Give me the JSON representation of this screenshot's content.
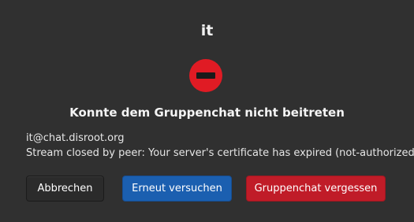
{
  "dialog": {
    "window_title": "it",
    "icon": "error-stop-icon",
    "heading": "Konnte dem Gruppenchat nicht beitreten",
    "jid": "it@chat.disroot.org",
    "reason": "Stream closed by peer: Your server's certificate has expired (not-authorized)"
  },
  "buttons": {
    "cancel_label": "Abbrechen",
    "retry_label": "Erneut versuchen",
    "forget_label": "Gruppenchat vergessen"
  },
  "colors": {
    "background": "#303030",
    "error_icon": "#e01b24",
    "suggested_action": "#1b5fb0",
    "destructive_action": "#c01c28"
  }
}
